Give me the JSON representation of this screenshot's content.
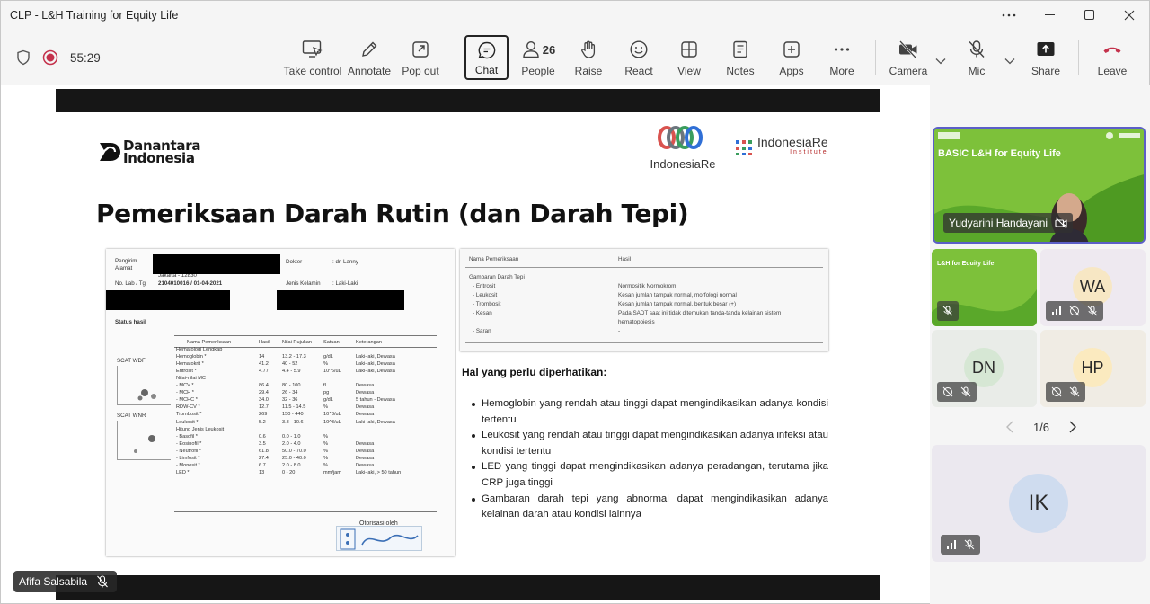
{
  "window": {
    "title": "CLP - L&H Training for Equity Life"
  },
  "call": {
    "timer": "55:29"
  },
  "toolbar": {
    "take_control": "Take control",
    "annotate": "Annotate",
    "pop_out": "Pop out",
    "chat": "Chat",
    "people": "People",
    "people_count": "26",
    "raise": "Raise",
    "react": "React",
    "view": "View",
    "notes": "Notes",
    "apps": "Apps",
    "more": "More",
    "camera": "Camera",
    "mic": "Mic",
    "share": "Share",
    "leave": "Leave"
  },
  "slide": {
    "logo_left_line1": "Danantara",
    "logo_left_line2": "Indonesia",
    "logo_mid_text": "IndonesiaRe",
    "logo_right_text": "IndonesiaRe",
    "logo_right_sub": "Institute",
    "title": "Pemeriksaan Darah Rutin (dan Darah Tepi)",
    "lab_report": {
      "pengirim": "Pengirim",
      "alamat": "Alamat",
      "no_lab": "No. Lab / Tgl",
      "no_lab_val": "2104010016 / 01-04-2021",
      "dokter": "Dokter",
      "dokter_val": ": dr. Lanny",
      "jenis_kelamin": "Jenis Kelamin",
      "jenis_kelamin_val": ": Laki-Laki",
      "kota": "Jakarta - 12830",
      "status_hasil": "Status hasil",
      "scat_wdf": "SCAT WDF",
      "scat_wnr": "SCAT WNR",
      "otorisasi": "Otorisasi oleh",
      "headers": [
        "Nama Pemeriksaan",
        "Hasil",
        "Nilai Rujukan",
        "Satuan",
        "Keterangan"
      ],
      "rows": [
        [
          "Hematologi Lengkap",
          "",
          "",
          "",
          ""
        ],
        [
          "Hemoglobin *",
          "14",
          "13.2 - 17.3",
          "g/dL",
          "Laki-laki, Dewasa"
        ],
        [
          "Hematokrit *",
          "41.2",
          "40 - 52",
          "%",
          "Laki-laki, Dewasa"
        ],
        [
          "Eritrosit *",
          "4.77",
          "4.4 - 5.9",
          "10^6/uL",
          "Laki-laki, Dewasa"
        ],
        [
          "Nilai-nilai MC",
          "",
          "",
          "",
          ""
        ],
        [
          "- MCV *",
          "86.4",
          "80 - 100",
          "fL",
          "Dewasa"
        ],
        [
          "- MCH *",
          "29.4",
          "26 - 34",
          "pg",
          "Dewasa"
        ],
        [
          "- MCHC *",
          "34.0",
          "32 - 36",
          "g/dL",
          "5 tahun - Dewasa"
        ],
        [
          "RDW-CV *",
          "12.7",
          "11.5 - 14.5",
          "%",
          "Dewasa"
        ],
        [
          "Trombosit *",
          "269",
          "150 - 440",
          "10^3/uL",
          "Dewasa"
        ],
        [
          "Leukosit *",
          "5.2",
          "3.8 - 10.6",
          "10^3/uL",
          "Laki-laki, Dewasa"
        ],
        [
          "Hitung Jenis Leukosit",
          "",
          "",
          "",
          ""
        ],
        [
          "- Basofil *",
          "0.6",
          "0.0 - 1.0",
          "%",
          ""
        ],
        [
          "- Eosinofil *",
          "3.5",
          "2.0 - 4.0",
          "%",
          "Dewasa"
        ],
        [
          "- Neutrofil *",
          "61.8",
          "50.0 - 70.0",
          "%",
          "Dewasa"
        ],
        [
          "- Limfosit *",
          "27.4",
          "25.0 - 40.0",
          "%",
          "Dewasa"
        ],
        [
          "- Monosit *",
          "6.7",
          "2.0 - 8.0",
          "%",
          "Dewasa"
        ],
        [
          "LED *",
          "13",
          "0 - 20",
          "mm/jam",
          "Laki-laki, > 50 tahun"
        ]
      ]
    },
    "darah_tepi": {
      "col1": "Nama Pemeriksaan",
      "col2": "Hasil",
      "section": "Gambaran Darah Tepi",
      "rows": [
        [
          "- Eritrosit",
          "Normositik Normokrom"
        ],
        [
          "- Leukosit",
          "Kesan jumlah tampak normal, morfologi normal"
        ],
        [
          "- Trombosit",
          "Kesan jumlah tampak normal, bentuk besar (+)"
        ],
        [
          "- Kesan",
          "Pada SADT saat ini tidak ditemukan tanda-tanda kelainan sistem"
        ],
        [
          "",
          "hematopoiesis"
        ],
        [
          "- Saran",
          "-"
        ]
      ]
    },
    "notes_heading": "Hal yang perlu diperhatikan:",
    "bullets": [
      "Hemoglobin yang rendah atau tinggi dapat mengindikasikan adanya kondisi tertentu",
      "Leukosit yang rendah atau tinggi dapat mengindikasikan adanya infeksi atau kondisi tertentu",
      "LED yang tinggi dapat mengindikasikan adanya peradangan, terutama jika CRP juga tinggi",
      "Gambaran darah tepi yang abnormal dapat mengindikasikan adanya kelainan darah atau kondisi lainnya"
    ]
  },
  "presenter": {
    "name": "Afifa Salsabila"
  },
  "participants": {
    "featured_name": "Yudyarini Handayani",
    "featured_slide_title": "BASIC L&H for Equity Life",
    "thumb_slide_title": "L&H for Equity Life",
    "wa": "WA",
    "dn": "DN",
    "hp": "HP",
    "ik": "IK",
    "pager": "1/6"
  },
  "colors": {
    "leave": "#c4314b",
    "accent": "#5b5fc7",
    "slide_green": "#8dc63f"
  }
}
